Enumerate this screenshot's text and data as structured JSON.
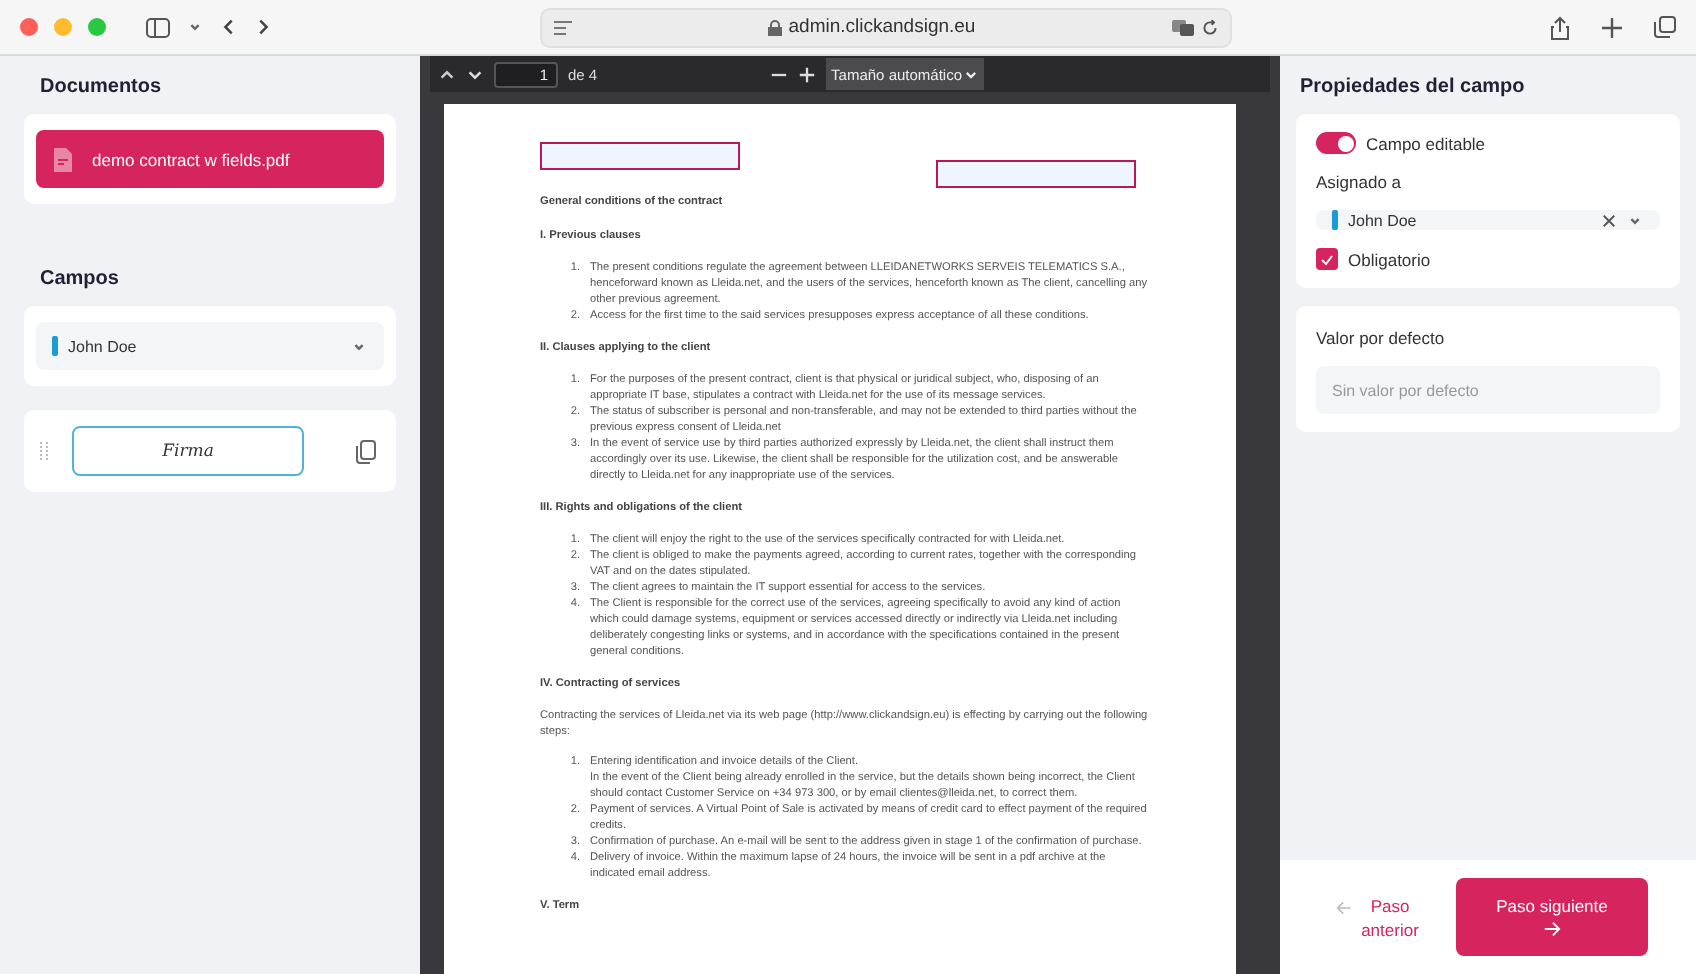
{
  "browser": {
    "url": "admin.clickandsign.eu"
  },
  "left_panel": {
    "documents_title": "Documentos",
    "documents": [
      {
        "name": "demo contract w fields.pdf",
        "selected": true
      }
    ],
    "fields_title": "Campos",
    "signer": {
      "name": "John Doe",
      "color": "#1a9bd7"
    },
    "fields": [
      {
        "label": "Firma",
        "selected": true
      }
    ]
  },
  "viewer": {
    "page": "1",
    "page_total": "de 4",
    "zoom": "Tamaño automático",
    "document": {
      "title": "General conditions of the contract",
      "sections": [
        {
          "heading": "I. Previous clauses",
          "items": [
            {
              "number": "1.",
              "text": "The present conditions regulate the agreement between LLEIDANETWORKS SERVEIS TELEMATICS S.A., henceforward known as Lleida.net, and the users of the services, henceforth known as The client, cancelling any other previous agreement."
            },
            {
              "number": "2.",
              "text": "Access for the first time to the said services presupposes express acceptance of all these conditions."
            }
          ]
        },
        {
          "heading": "II. Clauses applying to the client",
          "items": [
            {
              "number": "1.",
              "text": "For the purposes of the present contract, client is that physical or juridical subject, who, disposing of an appropriate IT base, stipulates a contract with Lleida.net for the use of its message services."
            },
            {
              "number": "2.",
              "text": "The status of subscriber is personal and non-transferable, and may not be extended to third parties without the previous express consent of Lleida.net"
            },
            {
              "number": "3.",
              "text": "In the event of service use by third parties authorized expressly by Lleida.net, the client shall instruct them accordingly over its use. Likewise, the client shall be responsible for the utilization cost, and be answerable directly to Lleida.net for any inappropriate use of the services."
            }
          ]
        },
        {
          "heading": "III. Rights and obligations of the client",
          "items": [
            {
              "number": "1.",
              "text": "The client will enjoy the right to the use of the services specifically contracted for with Lleida.net."
            },
            {
              "number": "2.",
              "text": "The client is obliged to make the payments agreed, according to current rates, together with the corresponding VAT and on the dates stipulated."
            },
            {
              "number": "3.",
              "text": "The client agrees to maintain the IT support essential for access to the services."
            },
            {
              "number": "4.",
              "text": "The Client is responsible for the correct use of the services, agreeing specifically to avoid any kind of action which could damage systems, equipment or services accessed directly or indirectly via Lleida.net including deliberately congesting links or systems, and in accordance with the specifications contained in the present general conditions."
            }
          ]
        },
        {
          "heading": "IV. Contracting of services",
          "intro": "Contracting the services of Lleida.net via its web page (http://www.clickandsign.eu) is effecting by carrying out the following steps:",
          "items": [
            {
              "number": "1.",
              "text": "Entering identification and invoice details of the Client.",
              "detail": "In the event of the Client being already enrolled in the service, but the details shown being incorrect, the Client should contact Customer Service on +34 973 300, or by email clientes@lleida.net, to correct them."
            },
            {
              "number": "2.",
              "text": "Payment of services. A Virtual Point of Sale is activated by means of credit card to effect payment of the required credits."
            },
            {
              "number": "3.",
              "text": "Confirmation of purchase. An e-mail will be sent to the address given in stage 1 of the confirmation of purchase."
            },
            {
              "number": "4.",
              "text": "Delivery of invoice. Within the maximum lapse of 24 hours, the invoice will be sent in a pdf archive at the indicated email address."
            }
          ]
        },
        {
          "heading": "V. Term"
        }
      ]
    }
  },
  "right_panel": {
    "title": "Propiedades del campo",
    "editable": {
      "label": "Campo editable",
      "on": true
    },
    "assigned_label": "Asignado a",
    "assigned": {
      "name": "John Doe",
      "color": "#1a9bd7"
    },
    "required": {
      "label": "Obligatorio",
      "checked": true
    },
    "default_title": "Valor por defecto",
    "default_placeholder": "Sin valor por defecto"
  },
  "footer": {
    "previous": "Paso anterior",
    "next": "Paso siguiente"
  }
}
